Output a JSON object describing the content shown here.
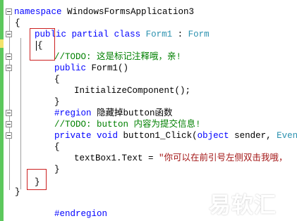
{
  "code": {
    "l1_kw": "namespace",
    "l1_name": " WindowsFormsApplication3",
    "l2": "{",
    "l3_kw1": "public",
    "l3_kw2": "partial",
    "l3_kw3": "class",
    "l3_name": "Form1",
    "l3_colon": " : ",
    "l3_base": "Form",
    "l4": "{",
    "l5_comment": "//TODO: 这是标记注释哦，亲!",
    "l6_kw": "public",
    "l6_rest": " Form1()",
    "l7": "{",
    "l8": "InitializeComponent();",
    "l9": "}",
    "l10_kw": "#region",
    "l10_rest": " 隐藏掉button函数",
    "l11_comment": "//TODO: button 内容为提交信息!",
    "l12_kw1": "private",
    "l12_kw2": "void",
    "l12_method": " button1_Click(",
    "l12_kw3": "object",
    "l12_args": " sender, ",
    "l12_type": "EventAr",
    "l13": "{",
    "l14_code": "textBox1.Text = ",
    "l14_str": "\"你可以在前引号左侧双击我哦，",
    "l15": "}",
    "l16": "}",
    "l17": "}",
    "l18": "#endregion"
  },
  "watermark": {
    "text": "易软汇"
  },
  "colors": {
    "keyword": "#0000ff",
    "type": "#2b91af",
    "comment": "#008000",
    "string": "#a31515",
    "highlight_box": "#cc2020",
    "change_bar": "#5cc85c"
  }
}
